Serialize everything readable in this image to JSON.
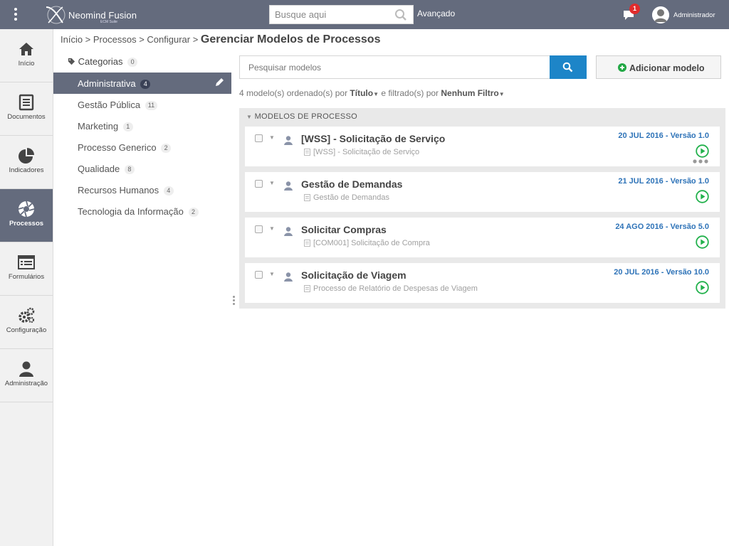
{
  "header": {
    "brand": "Neomind Fusion",
    "brand_sub": "ECM Suite",
    "search_placeholder": "Busque aqui",
    "advanced_label": "Avançado",
    "notification_count": "1",
    "user_name": "Administrador"
  },
  "nav": [
    {
      "label": "Início",
      "icon": "home-icon"
    },
    {
      "label": "Documentos",
      "icon": "documents-icon"
    },
    {
      "label": "Indicadores",
      "icon": "pie-chart-icon"
    },
    {
      "label": "Processos",
      "icon": "aperture-icon",
      "active": true
    },
    {
      "label": "Formulários",
      "icon": "form-list-icon"
    },
    {
      "label": "Configuração",
      "icon": "gears-icon"
    },
    {
      "label": "Administração",
      "icon": "user-admin-icon"
    }
  ],
  "breadcrumb": {
    "path": "Início > Processos > Configurar >",
    "current": "Gerenciar Modelos de Processos"
  },
  "categories": {
    "header": "Categorias",
    "header_count": "0",
    "items": [
      {
        "label": "Administrativa",
        "count": "4"
      },
      {
        "label": "Gestão Pública",
        "count": "11"
      },
      {
        "label": "Marketing",
        "count": "1"
      },
      {
        "label": "Processo Generico",
        "count": "2"
      },
      {
        "label": "Qualidade",
        "count": "8"
      },
      {
        "label": "Recursos Humanos",
        "count": "4"
      },
      {
        "label": "Tecnologia da Informação",
        "count": "2"
      }
    ]
  },
  "main": {
    "search_placeholder": "Pesquisar modelos",
    "add_label": "Adicionar modelo",
    "filter": {
      "prefix": "4 modelo(s) ordenado(s) por",
      "sort": "Título",
      "middle": "e filtrado(s) por",
      "filter": "Nenhum Filtro"
    },
    "section_title": "MODELOS DE PROCESSO",
    "models": [
      {
        "title": "[WSS] - Solicitação de Serviço",
        "subtitle": "[WSS] - Solicitação de Serviço",
        "date": "20 JUL 2016 - Versão 1.0"
      },
      {
        "title": "Gestão de Demandas",
        "subtitle": "Gestão de Demandas",
        "date": "21 JUL 2016 - Versão 1.0"
      },
      {
        "title": "Solicitar Compras",
        "subtitle": "[COM001] Solicitação de Compra",
        "date": "24 AGO 2016 - Versão 5.0"
      },
      {
        "title": "Solicitação de Viagem",
        "subtitle": "Processo de Relatório de Despesas de Viagem",
        "date": "20 JUL 2016 - Versão 10.0"
      }
    ]
  },
  "colors": {
    "topbar": "#646b7d",
    "accent": "#1d85c8",
    "date_link": "#2e73b8",
    "play": "#22b14c",
    "badge_red": "#e02b2b"
  }
}
